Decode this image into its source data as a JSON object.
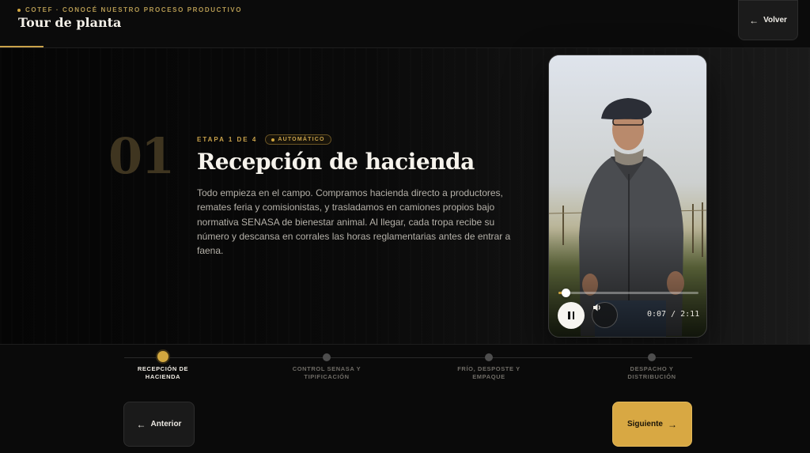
{
  "header": {
    "eyebrow": "COTEF · CONOCÉ NUESTRO PROCESO PRODUCTIVO",
    "title": "Tour de planta",
    "back_label": "Volver"
  },
  "stage": {
    "number": "01",
    "step_label": "ETAPA 1 DE 4",
    "mode_badge": "AUTOMÁTICO",
    "title": "Recepción de hacienda",
    "description": "Todo empieza en el campo. Compramos hacienda directo a productores, remates feria y comisionistas, y trasladamos en camiones propios bajo normativa SENASA de bienestar animal. Al llegar, cada tropa recibe su número y descansa en corrales las horas reglamentarias antes de entrar a faena."
  },
  "video": {
    "time": "0:07 / 2:11",
    "progress": 0.053,
    "state": "playing"
  },
  "steps": [
    {
      "label_line1": "RECEPCIÓN DE",
      "label_line2": "HACIENDA",
      "active": true
    },
    {
      "label_line1": "CONTROL SENASA Y",
      "label_line2": "TIPIFICACIÓN",
      "active": false
    },
    {
      "label_line1": "FRÍO, DESPOSTE Y",
      "label_line2": "EMPAQUE",
      "active": false
    },
    {
      "label_line1": "DESPACHO Y",
      "label_line2": "DISTRIBUCIÓN",
      "active": false
    }
  ],
  "nav": {
    "prev_label": "Anterior",
    "next_label": "Siguiente"
  },
  "colors": {
    "accent": "#d2a73f",
    "background": "#070707",
    "next_button": "#d8a843"
  }
}
